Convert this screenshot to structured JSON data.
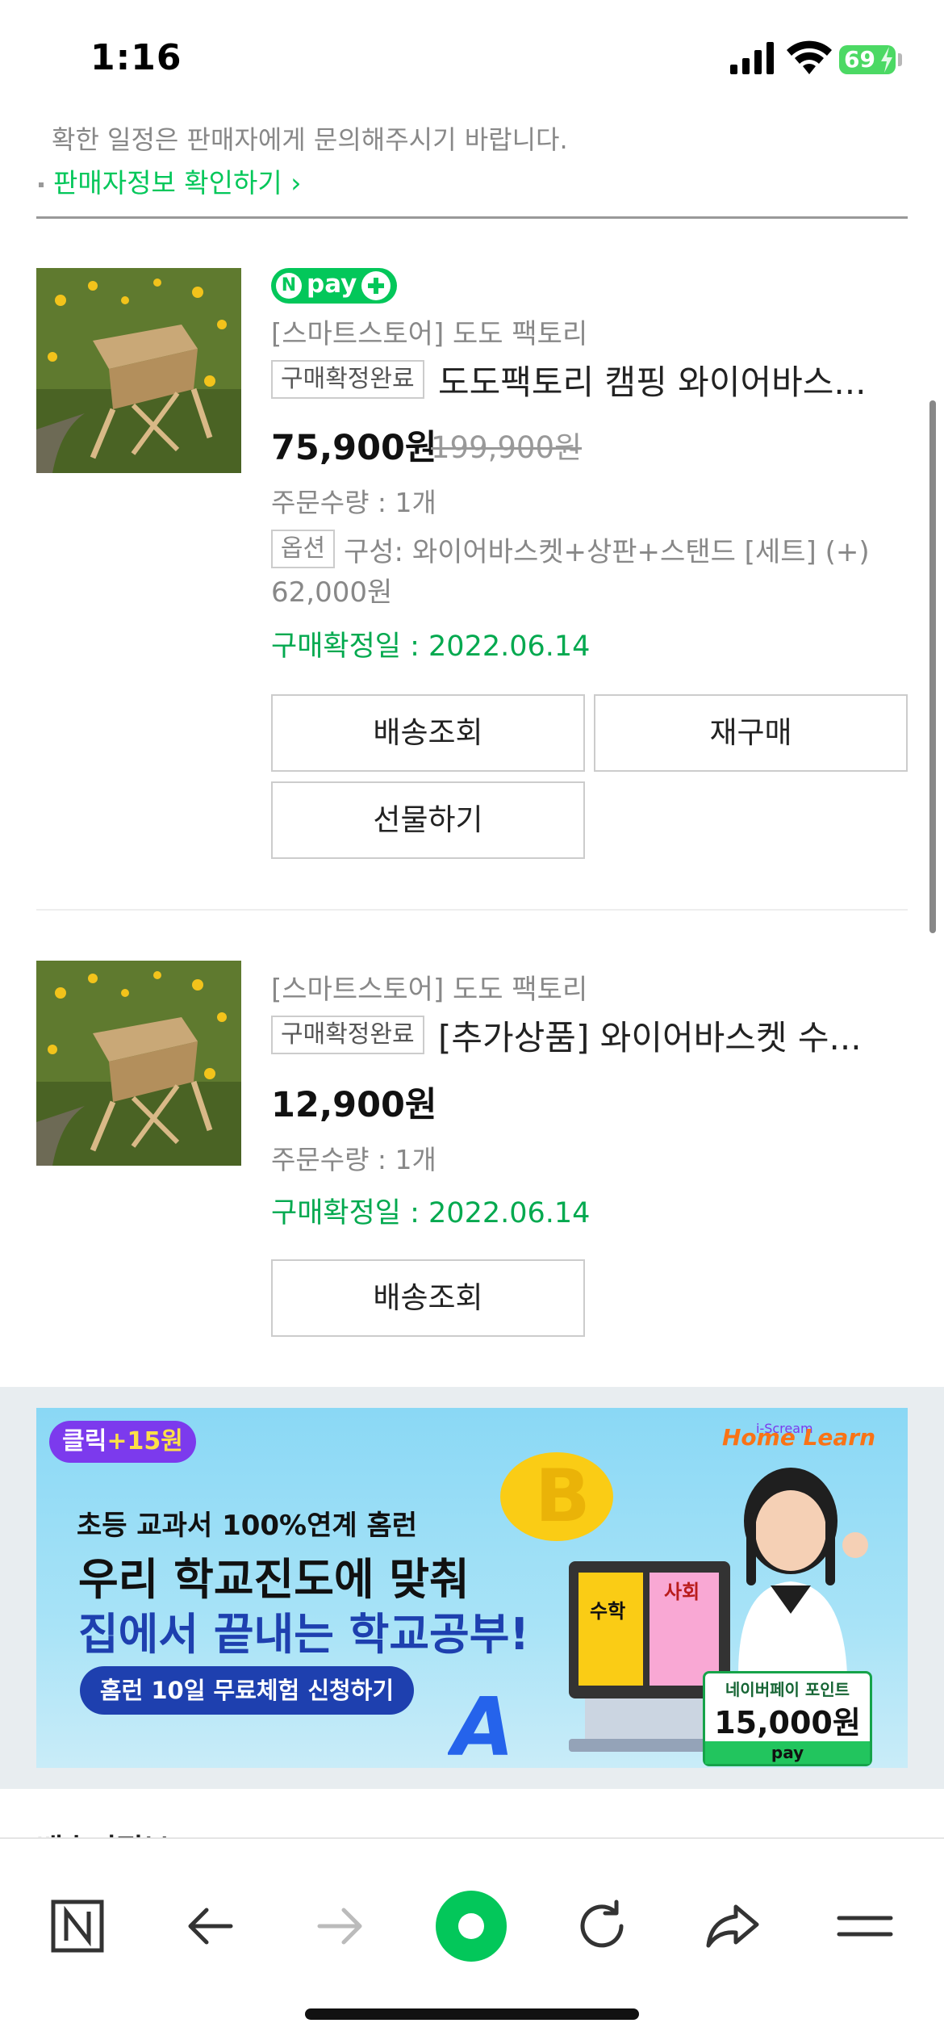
{
  "status_bar": {
    "time": "1:16",
    "battery": "69"
  },
  "notice": {
    "text": "확한 일정은 판매자에게 문의해주시기 바랍니다.",
    "seller_link": "판매자정보 확인하기"
  },
  "orders": [
    {
      "badge": "pay",
      "store": "[스마트스토어] 도도 팩토리",
      "status": "구매확정완료",
      "name": "도도팩토리 캠핑 와이어바스...",
      "price": "75,900원",
      "original_price": "199,900원",
      "quantity": "주문수량 : 1개",
      "option_label": "옵션",
      "option_text": "구성: 와이어바스켓+상판+스탠드 [세트] (+)",
      "option_price": "62,000원",
      "confirm_date": "구매확정일 : 2022.06.14",
      "buttons": [
        "배송조회",
        "재구매",
        "선물하기"
      ]
    },
    {
      "store": "[스마트스토어] 도도 팩토리",
      "status": "구매확정완료",
      "name": "[추가상품] 와이어바스켓 수...",
      "price": "12,900원",
      "quantity": "주문수량 : 1개",
      "confirm_date": "구매확정일 : 2022.06.14",
      "buttons": [
        "배송조회"
      ]
    }
  ],
  "ad": {
    "click_badge": "클릭",
    "click_bonus": "+15원",
    "brand_small": "i-Scream",
    "brand": "Home Learn",
    "subtitle": "초등 교과서 100%연계 홈런",
    "title_line1": "우리 학교진도에 맞춰",
    "title_line2": "집에서 끝내는 학교공부!",
    "cta": "홈런 10일 무료체험 신청하기",
    "point_label": "네이버페이 포인트",
    "point_value": "15,000원",
    "point_pay": "pay",
    "book1": "수학",
    "book2": "사회"
  },
  "next_section_heading": "배송지정보",
  "colors": {
    "naver_green": "#03c75a",
    "date_green": "#03a94f",
    "ad_purple": "#7c3aed",
    "ad_blue": "#1e40af"
  },
  "toolbar_icons": [
    "naver-home-icon",
    "back-arrow-icon",
    "forward-arrow-icon",
    "green-dot-icon",
    "refresh-icon",
    "share-icon",
    "menu-icon"
  ]
}
